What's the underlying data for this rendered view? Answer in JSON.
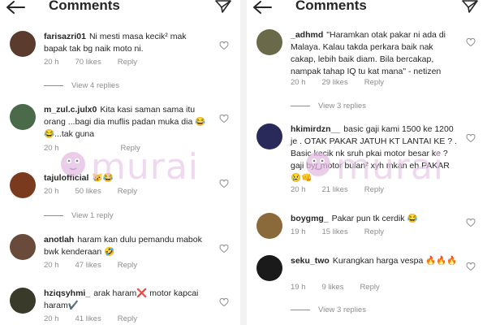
{
  "header": {
    "title": "Comments"
  },
  "watermark": {
    "text": "murai"
  },
  "left": {
    "comments": [
      {
        "username": "farisazri01",
        "text": "Ni mesti masa kecik² mak bapak tak bg naik moto ni.",
        "time": "20 h",
        "likes": "70 likes",
        "reply": "Reply",
        "view_replies": "View 4 replies",
        "avatar_color": "#5a3b2e"
      },
      {
        "username": "m_zul.c.julx0",
        "text": "Kita kasi saman sama itu orang ...bagi dia muflis padan muka dia 😂😂...tak guna",
        "time": "20 h",
        "likes": "",
        "reply": "Reply",
        "view_replies": "",
        "avatar_color": "#4a6a4a"
      },
      {
        "username": "tajulofficial",
        "text": "😿😂",
        "time": "20 h",
        "likes": "50 likes",
        "reply": "Reply",
        "view_replies": "View 1 reply",
        "avatar_color": "#7a3a1e"
      },
      {
        "username": "anotlah",
        "text": "haram kan dulu pemandu mabok bwk kenderaan 🤣",
        "time": "20 h",
        "likes": "47 likes",
        "reply": "Reply",
        "view_replies": "",
        "avatar_color": "#6a4a3a"
      },
      {
        "username": "hziqsyhmi_",
        "text": "arak haram❌ motor kapcai haram✔️",
        "time": "20 h",
        "likes": "41 likes",
        "reply": "Reply",
        "view_replies": "",
        "avatar_color": "#3a3a2a"
      }
    ]
  },
  "right": {
    "comments": [
      {
        "username": "_adhmd",
        "text": "\"Haramkan otak pakar ni ada di Malaya. Kalau takda perkara baik nak cakap, lebih baik diam. Bila bercakap, nampak tahap IQ tu kat mana\" - netizen",
        "time": "20 h",
        "likes": "29 likes",
        "reply": "Reply",
        "view_replies": "View 3 replies",
        "avatar_color": "#6a6a4a"
      },
      {
        "username": "hkimirdzn__",
        "text": "basic gaji kami 1500 ke 1200 je . OTAK PAKAR JATUH KT LANTAI KE ? . Basic kecik nk sruh pkai motor besar ke ? gaji byr motor bulan² xyh mkan eh PAKAR 😢👊",
        "time": "20 h",
        "likes": "21 likes",
        "reply": "Reply",
        "view_replies": "",
        "avatar_color": "#2a2a5a"
      },
      {
        "username": "boygmg_",
        "text": "Pakar pun tk cerdik 😂",
        "time": "19 h",
        "likes": "15 likes",
        "reply": "Reply",
        "view_replies": "",
        "avatar_color": "#8a6a3a"
      },
      {
        "username": "seku_two",
        "text": "Kurangkan harga vespa 🔥🔥🔥",
        "time": "19 h",
        "likes": "9 likes",
        "reply": "Reply",
        "view_replies": "View 3 replies",
        "avatar_color": "#1a1a1a"
      }
    ]
  }
}
